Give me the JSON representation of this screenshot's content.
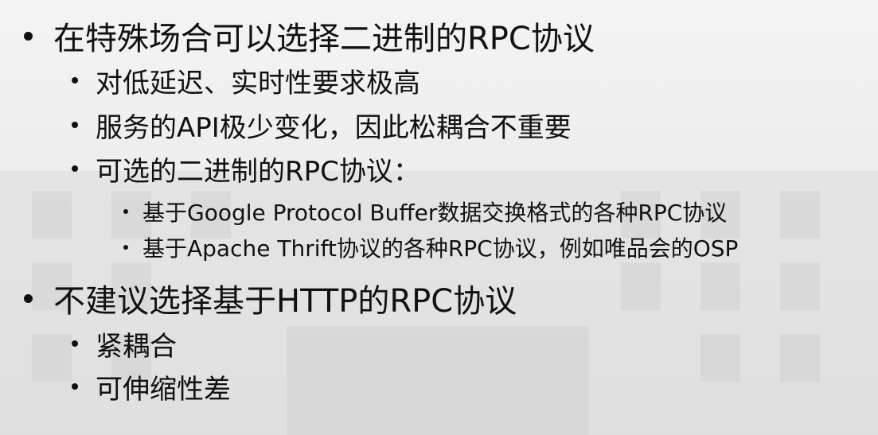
{
  "slide": {
    "items": [
      {
        "level": 1,
        "text": "在特殊场合可以选择二进制的RPC协议"
      },
      {
        "level": 2,
        "text": "对低延迟、实时性要求极高"
      },
      {
        "level": 2,
        "text": "服务的API极少变化，因此松耦合不重要"
      },
      {
        "level": 2,
        "text": "可选的二进制的RPC协议："
      },
      {
        "level": 3,
        "text": "基于Google Protocol Buffer数据交换格式的各种RPC协议"
      },
      {
        "level": 3,
        "text": "基于Apache Thrift协议的各种RPC协议，例如唯品会的OSP"
      },
      {
        "level": 1,
        "text": "不建议选择基于HTTP的RPC协议"
      },
      {
        "level": 2,
        "text": "紧耦合"
      },
      {
        "level": 2,
        "text": "可伸缩性差"
      }
    ]
  }
}
